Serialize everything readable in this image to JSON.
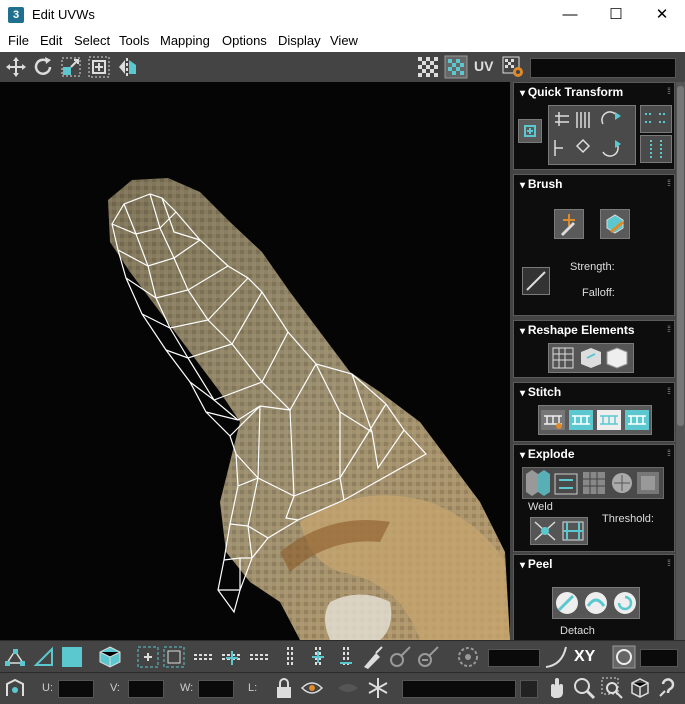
{
  "window": {
    "app_icon": "3",
    "title": "Edit UVWs",
    "minimize": "—",
    "maximize": "☐",
    "close": "✕"
  },
  "menu": [
    "File",
    "Edit",
    "Select",
    "Tools",
    "Mapping",
    "Options",
    "Display",
    "View"
  ],
  "toolbar": {
    "uv_label": "UV"
  },
  "panel": {
    "quick_transform": "Quick Transform",
    "brush": "Brush",
    "strength": "Strength:",
    "falloff": "Falloff:",
    "reshape": "Reshape Elements",
    "stitch": "Stitch",
    "explode": "Explode",
    "weld": "Weld",
    "threshold": "Threshold:",
    "peel": "Peel",
    "detach": "Detach"
  },
  "bottom": {
    "xy": "XY",
    "u": "U:",
    "v": "V:",
    "w": "W:",
    "l": "L:"
  },
  "colors": {
    "accent": "#5bc8d0",
    "wire": "#ffffff",
    "viewport_bg": "#050505"
  }
}
